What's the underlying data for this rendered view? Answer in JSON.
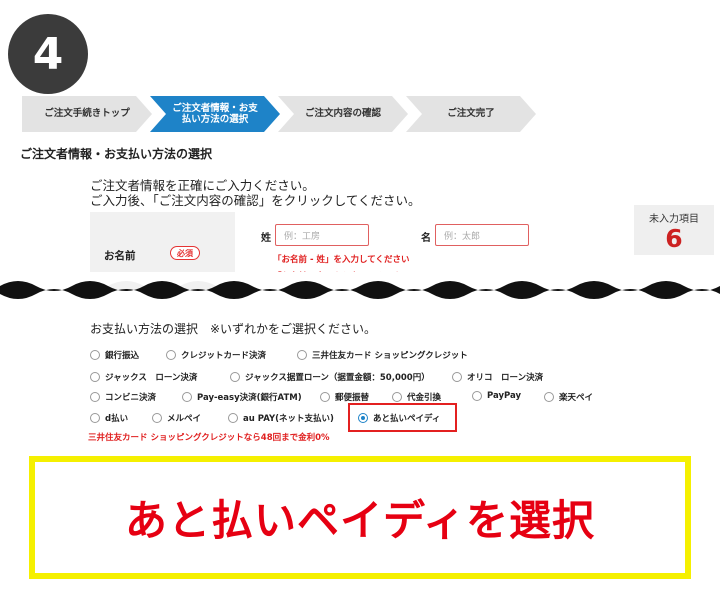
{
  "step_number": "4",
  "steps": [
    {
      "label": "ご注文手続きトップ",
      "state": "inactive"
    },
    {
      "label": "ご注文者情報・お支払い方法の選択",
      "state": "active"
    },
    {
      "label": "ご注文内容の確認",
      "state": "inactive"
    },
    {
      "label": "ご注文完了",
      "state": "inactive"
    }
  ],
  "section_title": "ご注文者情報・お支払い方法の選択",
  "intro": {
    "line1": "ご注文者情報を正確にご入力ください。",
    "line2": "ご入力後、「ご注文内容の確認」をクリックしてください。"
  },
  "remaining": {
    "label": "未入力項目",
    "count": "6"
  },
  "name_form": {
    "label": "お名前",
    "required_badge": "必須",
    "last_name_label": "姓",
    "last_name_placeholder": "例：工房",
    "first_name_label": "名",
    "first_name_placeholder": "例：太郎",
    "error_last": "「お名前 - 姓」を入力してください",
    "error_first": "「お名前 - 名」を入力してください"
  },
  "payment": {
    "title": "お支払い方法の選択　※いずれかをご選択ください。",
    "options": [
      {
        "label": "銀行振込",
        "checked": false
      },
      {
        "label": "クレジットカード決済",
        "checked": false
      },
      {
        "label": "三井住友カード ショッピングクレジット",
        "checked": false
      },
      {
        "label": "ジャックス　ローン決済",
        "checked": false
      },
      {
        "label": "ジャックス据置ローン（据置金額：50,000円）",
        "checked": false
      },
      {
        "label": "オリコ　ローン決済",
        "checked": false
      },
      {
        "label": "コンビニ決済",
        "checked": false
      },
      {
        "label": "Pay-easy決済(銀行ATM)",
        "checked": false
      },
      {
        "label": "郵便振替",
        "checked": false
      },
      {
        "label": "代金引換",
        "checked": false
      },
      {
        "label": "PayPay",
        "checked": false
      },
      {
        "label": "楽天ペイ",
        "checked": false
      },
      {
        "label": "d払い",
        "checked": false
      },
      {
        "label": "メルペイ",
        "checked": false
      },
      {
        "label": "au PAY(ネット支払い)",
        "checked": false
      },
      {
        "label": "あと払いペイディ",
        "checked": true
      }
    ],
    "promo": "三井住友カード ショッピングクレジットなら48回まで金利0%"
  },
  "callout": "あと払いペイディを選択",
  "colors": {
    "active_step": "#1e83c8",
    "error_red": "#e02020",
    "callout_border": "#f5f000",
    "callout_text": "#e60012"
  }
}
